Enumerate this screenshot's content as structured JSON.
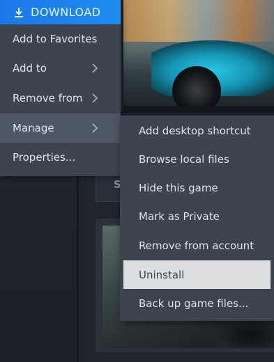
{
  "main_menu": {
    "download_label": "DOWNLOAD",
    "items": [
      {
        "label": "Add to Favorites"
      },
      {
        "label": "Add to"
      },
      {
        "label": "Remove from"
      },
      {
        "label": "Manage"
      },
      {
        "label": "Properties..."
      }
    ]
  },
  "sub_menu": {
    "items": [
      {
        "label": "Add desktop shortcut"
      },
      {
        "label": "Browse local files"
      },
      {
        "label": "Hide this game"
      },
      {
        "label": "Mark as Private"
      },
      {
        "label": "Remove from account"
      },
      {
        "label": "Uninstall"
      },
      {
        "label": "Back up game files..."
      }
    ]
  },
  "background": {
    "panel_initial": "S"
  },
  "colors": {
    "download_blue": "#1a7ce9",
    "menu_bg": "#3d4450",
    "hover_bg": "#dcdedf",
    "text": "#dfe3e8"
  },
  "icons": {
    "download": "download-icon",
    "submenu": "chevron-right-icon"
  }
}
